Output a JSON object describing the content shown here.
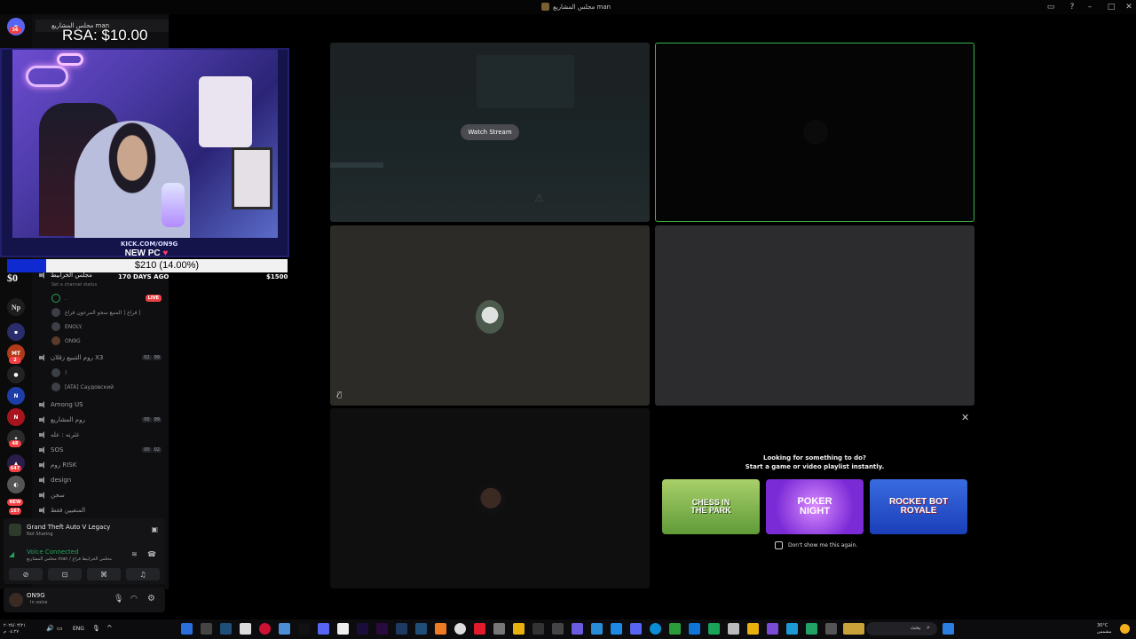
{
  "window": {
    "title": "مجلس المشاريع man"
  },
  "overlay": {
    "sub_price": "RSA: $10.00",
    "kick_handle": "KICK.COM/ON9G",
    "goal_title": "NEW PC",
    "goal_amount": "$210 (14.00%)",
    "goal_progress": 0.14,
    "goal_min": "$0",
    "goal_max": "$1500",
    "goal_days": "170 DAYS AGO"
  },
  "channels": {
    "server_name": "مجلس المشاريع man",
    "items": [
      {
        "name": "مجلس الخرابيط",
        "status": "Set a channel status"
      },
      {
        "name": "روم التنبيع زقلان X3",
        "count_a": "02",
        "count_b": "99"
      },
      {
        "name": "Among US"
      },
      {
        "name": "روم المشاريع",
        "count_a": "00",
        "count_b": "99"
      },
      {
        "name": "غثرنه : عله"
      },
      {
        "name": "SOS",
        "count_a": "00",
        "count_b": "02"
      },
      {
        "name": "روم RISK"
      },
      {
        "name": "design"
      },
      {
        "name": "سجن"
      },
      {
        "name": "المنفيين فقط"
      }
    ],
    "users": [
      {
        "name": ".",
        "live": "LIVE"
      },
      {
        "name": "فراغ | المنبع سجو المرعون فراغ |"
      },
      {
        "name": "ENOLY."
      },
      {
        "name": "ON9G"
      },
      {
        "name": "!"
      },
      {
        "name": "[ATA] Саудовский"
      }
    ]
  },
  "activity": {
    "game": "Grand Theft Auto V Legacy",
    "game_status": "Not Sharing",
    "voice_status": "Voice Connected",
    "voice_channel": "مجلس المشاريع man / مجلس الخرابيط فراغ"
  },
  "user": {
    "name": "ON9G",
    "status": "In voice"
  },
  "stage": {
    "watch_label": "Watch Stream",
    "activity_prompt_line1": "Looking for something to do?",
    "activity_prompt_line2": "Start a game or video playlist instantly.",
    "dont_show": "Don't show me this again.",
    "games": [
      {
        "name": "CHESS IN THE PARK"
      },
      {
        "name": "POKER NIGHT"
      },
      {
        "name": "ROCKET BOT ROYALE"
      }
    ]
  },
  "server_rail": {
    "badges": [
      "36",
      "2",
      "48",
      "647",
      "NEW",
      "167"
    ],
    "labels": [
      "Np",
      "MT",
      "N",
      "N"
    ]
  },
  "taskbar": {
    "lang": "ENG",
    "search_placeholder": "بحث",
    "temp": "30°C",
    "weather": "مشمس",
    "time": "٠٤:٢٧ م",
    "date": "٢٠٢٥/٠٣/٢١"
  },
  "colors": {
    "accent_green": "#23a55a",
    "live_red": "#ed4245",
    "goal_blue": "#0f2ad1"
  }
}
